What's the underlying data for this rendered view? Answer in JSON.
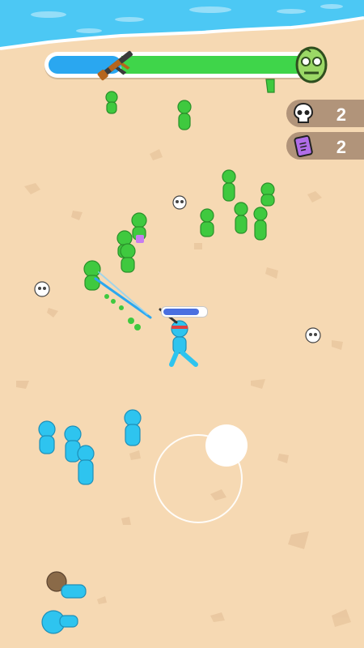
{
  "hud": {
    "weapon_icon": "assault-rifle-icon",
    "boss_icon": "zombie-head-icon",
    "progress_fraction": 0.28,
    "colors": {
      "progress_blue": "#2aa7f0",
      "progress_green": "#3fd54a"
    }
  },
  "counters": {
    "kills": {
      "icon": "skull-icon",
      "value": "2"
    },
    "cards": {
      "icon": "card-icon",
      "value": "2"
    }
  },
  "player": {
    "health_fraction": 0.85
  },
  "colors": {
    "sand": "#f6d9b3",
    "water": "#4cc8f4",
    "zombie": "#3fc93f",
    "ally": "#2ec4ef"
  }
}
